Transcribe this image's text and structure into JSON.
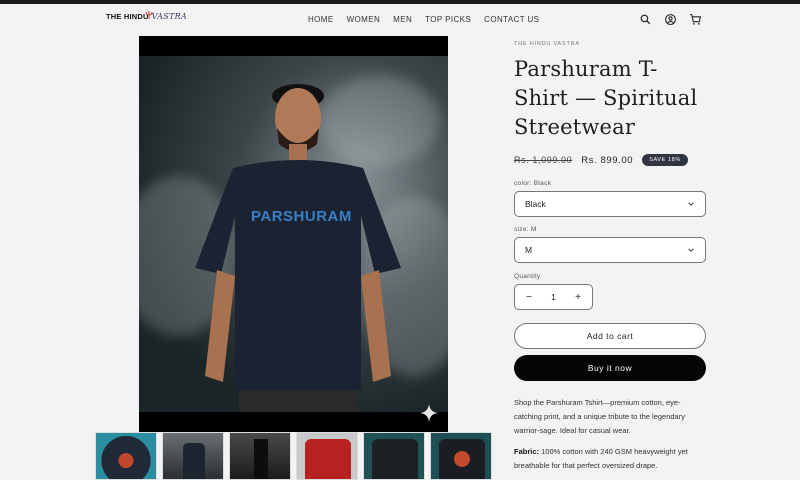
{
  "brand": {
    "part1": "THE HINDU",
    "part2": "VASTRA"
  },
  "nav": [
    "HOME",
    "WOMEN",
    "MEN",
    "TOP PICKS",
    "CONTACT US"
  ],
  "header_icons": [
    "search-icon",
    "account-icon",
    "cart-icon"
  ],
  "product": {
    "vendor": "THE HINDU VASTRA",
    "title": "Parshuram T-Shirt — Spiritual Streetwear",
    "old_price": "Rs. 1,099.00",
    "price": "Rs. 899.00",
    "badge": "SAVE 18%",
    "color_label": "color: Black",
    "color_value": "Black",
    "size_label": "size: M",
    "size_value": "M",
    "quantity_label": "Quantity",
    "quantity": "1",
    "minus": "−",
    "plus": "+",
    "add_to_cart": "Add to cart",
    "buy_now": "Buy it now",
    "description": "Shop the Parshuram Tshirt—premium cotton, eye-catching print, and a unique tribute to the legendary warrior-sage. Ideal for casual wear.",
    "fabric_label": "Fabric:",
    "fabric_text": "100% cotton with 240 GSM heavyweight yet breathable for that perfect oversized drape.",
    "shirt_print": "PARSHURAM"
  },
  "colors": {
    "accent": "#050505",
    "badge": "#2f3640",
    "print": "#3a7fc4",
    "page_bg": "#f3f3f3"
  }
}
